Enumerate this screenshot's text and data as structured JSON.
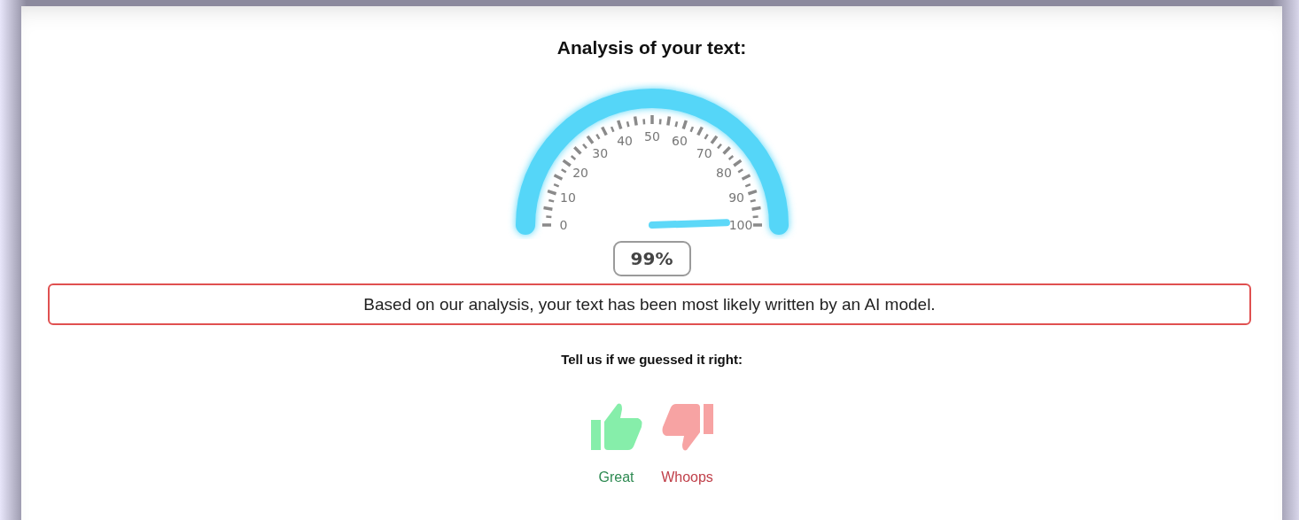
{
  "title": "Analysis of your text:",
  "gauge": {
    "level": 0.99,
    "tick_labels": [
      "0",
      "10",
      "20",
      "30",
      "40",
      "50",
      "60",
      "70",
      "80",
      "90",
      "100"
    ],
    "reading": "99%"
  },
  "verdict": "Based on our analysis, your text has been most likely written by an AI model.",
  "feedback_prompt": "Tell us if we guessed it right:",
  "feedback": [
    {
      "kind": "up",
      "label": "Great"
    },
    {
      "kind": "down",
      "label": "Whoops"
    }
  ]
}
